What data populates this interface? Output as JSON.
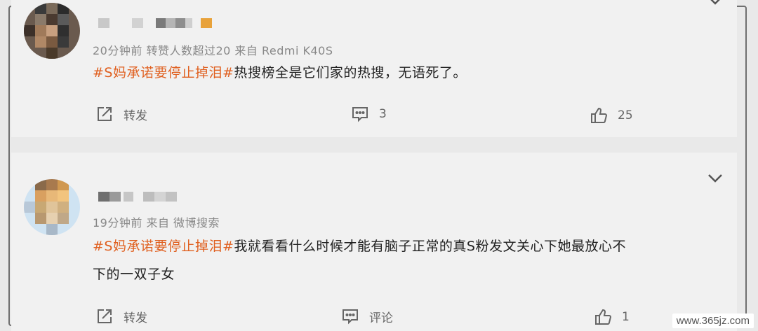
{
  "comments": [
    {
      "meta": "20分钟前  转赞人数超过20  来自 Redmi K40S",
      "hashtag": "#S妈承诺要停止掉泪#",
      "text": "热搜榜全是它们家的热搜，无语死了。",
      "actions": {
        "repost": "转发",
        "comment": "3",
        "like": "25"
      }
    },
    {
      "meta": "19分钟前  来自 微博搜索",
      "hashtag": "#S妈承诺要停止掉泪#",
      "text_line1": "我就看看什么时候才能有脑子正常的真S粉发文关心下她最放心不",
      "text_line2": "下的一双子女",
      "actions": {
        "repost": "转发",
        "comment": "评论",
        "like": "1"
      }
    }
  ],
  "icons": {
    "repost": "repost-icon",
    "comment": "comment-icon",
    "like": "thumbs-up-icon",
    "more": "chevron-down-icon"
  },
  "colors": {
    "hashtag": "#e06020",
    "card": "#f1f1f1",
    "meta": "#888888"
  },
  "watermark": "www.365jz.com"
}
